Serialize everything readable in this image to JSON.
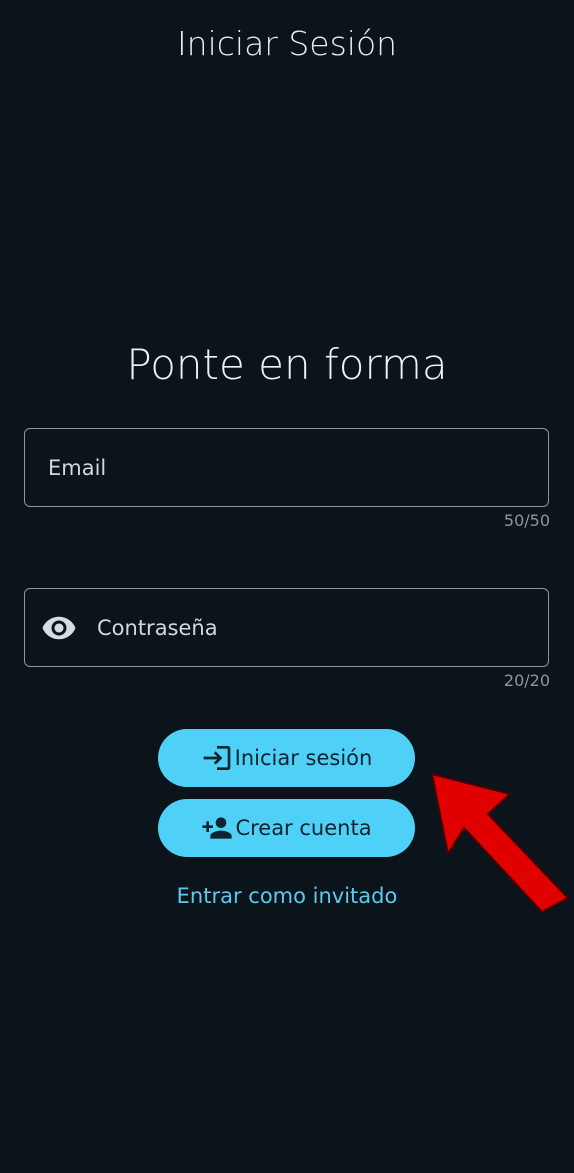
{
  "header": {
    "title": "Iniciar Sesión"
  },
  "main": {
    "heading": "Ponte en forma",
    "email": {
      "placeholder": "Email",
      "counter": "50/50"
    },
    "password": {
      "placeholder": "Contraseña",
      "counter": "20/20",
      "icon": "eye-icon"
    },
    "login_button": {
      "label": "Iniciar sesión",
      "icon": "login-icon"
    },
    "register_button": {
      "label": "Crear cuenta",
      "icon": "person-add-icon"
    },
    "guest_link": "Entrar como invitado"
  },
  "colors": {
    "background": "#0b131b",
    "button": "#4fd0f6",
    "link": "#5cc9ee",
    "annotation_arrow": "#e00000"
  }
}
